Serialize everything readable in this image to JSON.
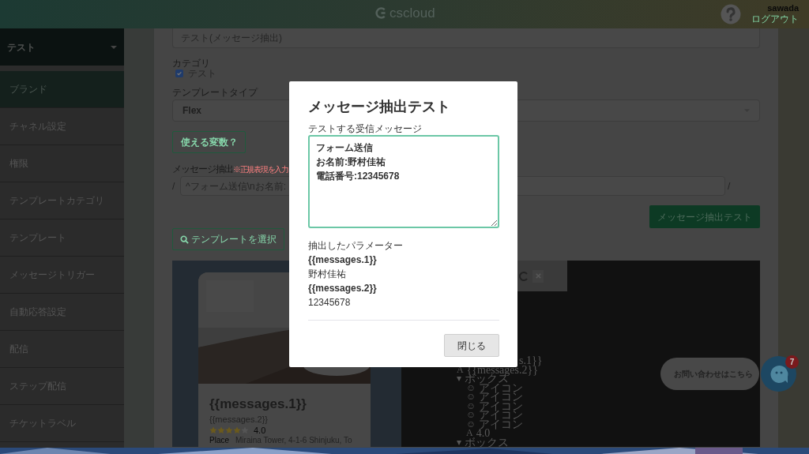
{
  "header": {
    "logo": "cscloud",
    "user": "sawada",
    "logout": "ログアウト"
  },
  "sidebar": {
    "project": "テスト",
    "items": [
      {
        "label": "ブランド",
        "selected": true
      },
      {
        "label": "チャネル設定",
        "selected": false
      },
      {
        "label": "権限",
        "selected": false
      },
      {
        "label": "テンプレートカテゴリ",
        "selected": false
      },
      {
        "label": "テンプレート",
        "selected": false
      },
      {
        "label": "メッセージトリガー",
        "selected": false
      },
      {
        "label": "自動応答設定",
        "selected": false
      },
      {
        "label": "配信",
        "selected": false
      },
      {
        "label": "ステップ配信",
        "selected": false
      },
      {
        "label": "チケットラベル",
        "selected": false
      }
    ]
  },
  "form": {
    "name_value": "テスト(メッセージ抽出)",
    "category_label": "カテゴリ",
    "categories": [
      {
        "label": "テスト",
        "checked": true
      }
    ],
    "type_label": "テンプレートタイプ",
    "type_value": "Flex",
    "variables_button": "使える変数？",
    "extract_label": "メッセージ抽出",
    "extract_note": "※正規表現を入力",
    "regex_open": "/",
    "regex_value": "^フォーム送信\\nお名前:",
    "regex_close": "/",
    "test_button": "メッセージ抽出テスト",
    "select_template_button": "テンプレートを選択"
  },
  "preview": {
    "card": {
      "title": "{{messages.1}}",
      "subtitle": "{{messages.2}}",
      "stars": 4,
      "rating": "4.0",
      "place_label": "Place",
      "place_value": "Miraina Tower, 4-1-6 Shinjuku, To"
    },
    "tree": [
      {
        "label": "s.1}}"
      },
      {
        "glyph": "A",
        "label": "{{messages.2}}"
      },
      {
        "glyph": "▾",
        "label": "ボックス",
        "children": [
          {
            "glyph": "☺",
            "label": "アイコン"
          },
          {
            "glyph": "☺",
            "label": "アイコン"
          },
          {
            "glyph": "☺",
            "label": "アイコン"
          },
          {
            "glyph": "☺",
            "label": "アイコン"
          },
          {
            "glyph": "☺",
            "label": "アイコン"
          },
          {
            "glyph": "A",
            "label": "4.0"
          }
        ]
      },
      {
        "glyph": "▾",
        "label": "ボックス"
      }
    ]
  },
  "modal": {
    "title": "メッセージ抽出テスト",
    "input_label": "テストする受信メッセージ",
    "message_lines": [
      "フォーム送信",
      "お名前:野村佳祐",
      "電話番号:12345678"
    ],
    "result_label": "抽出したパラメーター",
    "params": [
      {
        "name": "{{messages.1}}",
        "value": "野村佳祐"
      },
      {
        "name": "{{messages.2}}",
        "value": "12345678"
      }
    ],
    "close_button": "閉じる"
  },
  "chat": {
    "label": "お問い合わせはこちら",
    "badge": "7"
  }
}
